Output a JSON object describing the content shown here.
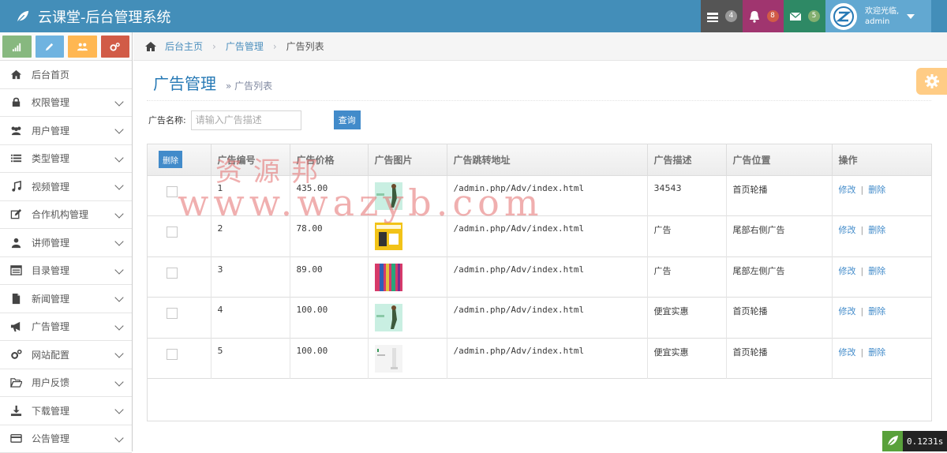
{
  "app": {
    "title": "云课堂-后台管理系统"
  },
  "navbar": {
    "tiles": [
      {
        "icon": "tasks-icon",
        "badge": "4",
        "bg": "#555555",
        "badge_bg": "#999999"
      },
      {
        "icon": "bell-icon",
        "badge": "8",
        "bg": "#a0356f",
        "badge_bg": "#d15b47"
      },
      {
        "icon": "envelope-icon",
        "badge": "5",
        "bg": "#2e8965",
        "badge_bg": "#82af6f"
      }
    ],
    "user": {
      "welcome": "欢迎光临,",
      "name": "admin"
    }
  },
  "sidebar": {
    "shortcuts": [
      {
        "icon": "signal-icon",
        "color": "#87b87f"
      },
      {
        "icon": "pencil-icon",
        "color": "#6fb3e0"
      },
      {
        "icon": "users-icon",
        "color": "#ffb752"
      },
      {
        "icon": "cogs-icon",
        "color": "#d15b47"
      }
    ],
    "items": [
      {
        "label": "后台首页",
        "icon": "home-icon",
        "expandable": false
      },
      {
        "label": "权限管理",
        "icon": "lock-icon",
        "expandable": true
      },
      {
        "label": "用户管理",
        "icon": "users-icon",
        "expandable": true
      },
      {
        "label": "类型管理",
        "icon": "list-icon",
        "expandable": true
      },
      {
        "label": "视频管理",
        "icon": "music-icon",
        "expandable": true
      },
      {
        "label": "合作机构管理",
        "icon": "edit-icon",
        "expandable": true
      },
      {
        "label": "讲师管理",
        "icon": "user-icon",
        "expandable": true
      },
      {
        "label": "目录管理",
        "icon": "list-alt-icon",
        "expandable": true
      },
      {
        "label": "新闻管理",
        "icon": "file-icon",
        "expandable": true
      },
      {
        "label": "广告管理",
        "icon": "bullhorn-icon",
        "expandable": true
      },
      {
        "label": "网站配置",
        "icon": "cogs-icon",
        "expandable": true
      },
      {
        "label": "用户反馈",
        "icon": "folder-open-icon",
        "expandable": true
      },
      {
        "label": "下载管理",
        "icon": "download-icon",
        "expandable": true
      },
      {
        "label": "公告管理",
        "icon": "credit-card-icon",
        "expandable": true
      }
    ]
  },
  "breadcrumb": {
    "home": "后台主页",
    "section": "广告管理",
    "current": "广告列表"
  },
  "page": {
    "title": "广告管理",
    "subtitle": "» 广告列表"
  },
  "search": {
    "label": "广告名称:",
    "placeholder": "请输入广告描述",
    "button": "查询"
  },
  "table": {
    "delete_button": "删除",
    "columns": [
      "广告编号",
      "广告价格",
      "广告图片",
      "广告跳转地址",
      "广告描述",
      "广告位置",
      "操作"
    ],
    "rows": [
      {
        "id": "1",
        "price": "435.00",
        "thumb": "thumb-1",
        "url": "/admin.php/Adv/index.html",
        "desc": "34543",
        "position": "首页轮播"
      },
      {
        "id": "2",
        "price": "78.00",
        "thumb": "thumb-2",
        "url": "/admin.php/Adv/index.html",
        "desc": "广告",
        "position": "尾部右侧广告"
      },
      {
        "id": "3",
        "price": "89.00",
        "thumb": "thumb-3",
        "url": "/admin.php/Adv/index.html",
        "desc": "广告",
        "position": "尾部左侧广告"
      },
      {
        "id": "4",
        "price": "100.00",
        "thumb": "thumb-4",
        "url": "/admin.php/Adv/index.html",
        "desc": "便宜实惠",
        "position": "首页轮播"
      },
      {
        "id": "5",
        "price": "100.00",
        "thumb": "thumb-5",
        "url": "/admin.php/Adv/index.html",
        "desc": "便宜实惠",
        "position": "首页轮播"
      }
    ],
    "actions": {
      "edit": "修改",
      "separator": "|",
      "delete": "删除"
    }
  },
  "watermark": {
    "line1": "资源邦",
    "line2": "www.wazyb.com"
  },
  "timer": {
    "value": "0.1231s"
  }
}
